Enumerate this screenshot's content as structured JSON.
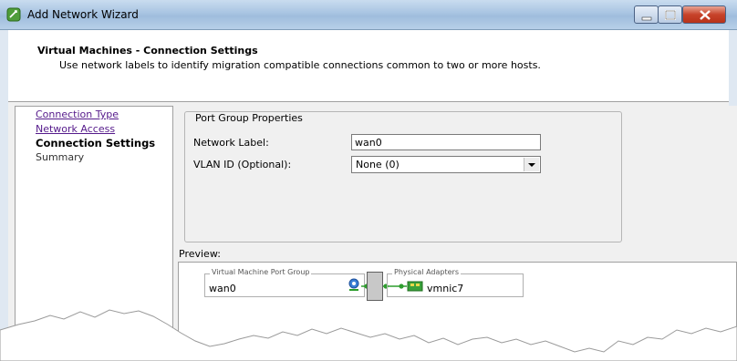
{
  "window": {
    "title": "Add Network Wizard"
  },
  "header": {
    "title": "Virtual Machines - Connection Settings",
    "subtitle": "Use network labels to identify migration compatible connections common to two or more hosts."
  },
  "nav": {
    "items": [
      {
        "label": "Connection Type",
        "state": "visited"
      },
      {
        "label": "Network Access",
        "state": "visited"
      },
      {
        "label": "Connection Settings",
        "state": "current"
      },
      {
        "label": "Summary",
        "state": "upcoming"
      }
    ]
  },
  "port_group": {
    "legend": "Port Group Properties",
    "network_label": {
      "label": "Network Label:",
      "value": "wan0"
    },
    "vlan": {
      "label": "VLAN ID (Optional):",
      "value": "None (0)"
    }
  },
  "preview": {
    "label": "Preview:",
    "vm_port_group": {
      "legend": "Virtual Machine Port Group",
      "name": "wan0"
    },
    "physical_adapters": {
      "legend": "Physical Adapters",
      "name": "vmnic7"
    }
  },
  "colors": {
    "link": "#551a8b",
    "accent": "#9fbddd",
    "close": "#c7432a",
    "connector": "#2e9e2e"
  }
}
